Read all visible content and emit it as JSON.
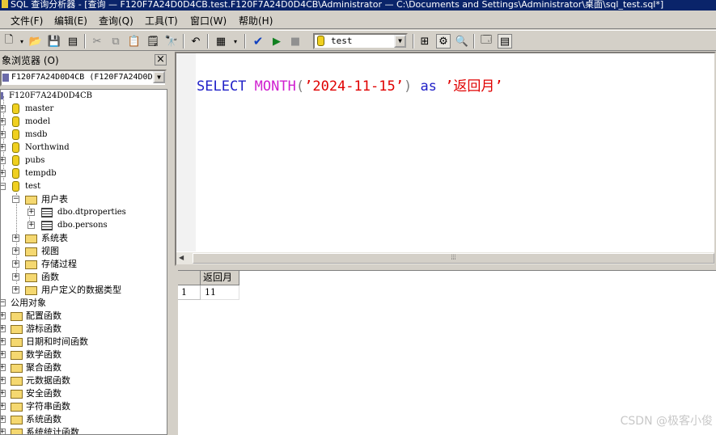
{
  "window": {
    "title": "SQL 查询分析器 - [查询 — F120F7A24D0D4CB.test.F120F7A24D0D4CB\\Administrator — C:\\Documents and Settings\\Administrator\\桌面\\sql_test.sql*]"
  },
  "menu": {
    "items": [
      "文件(F)",
      "编辑(E)",
      "查询(Q)",
      "工具(T)",
      "窗口(W)",
      "帮助(H)"
    ]
  },
  "toolbar": {
    "database": "test"
  },
  "object_browser": {
    "title": "象浏览器 (O)",
    "close": "×",
    "server_combo": "F120F7A24D0D4CB (F120F7A24D0D4C",
    "server_node": "F120F7A24D0D4CB",
    "databases": [
      "master",
      "model",
      "msdb",
      "Northwind",
      "pubs",
      "tempdb",
      "test"
    ],
    "test_children": {
      "user_tables": "用户表",
      "tables": [
        "dbo.dtproperties",
        "dbo.persons"
      ],
      "folders": [
        "系统表",
        "视图",
        "存储过程",
        "函数",
        "用户定义的数据类型"
      ]
    },
    "public_objects": "公用对象",
    "public_folders": [
      "配置函数",
      "游标函数",
      "日期和时间函数",
      "数学函数",
      "聚合函数",
      "元数据函数",
      "安全函数",
      "字符串函数",
      "系统函数",
      "系统统计函数"
    ]
  },
  "editor": {
    "tokens": {
      "select": "SELECT",
      "month": "MONTH",
      "open_paren": "(",
      "date_literal": "’2024-11-15’",
      "close_paren": ")",
      "as": "as",
      "alias_literal": "’返回月’"
    }
  },
  "results": {
    "column": "返回月",
    "row_number": "1",
    "value": "11"
  },
  "watermark": "CSDN @极客小俊"
}
